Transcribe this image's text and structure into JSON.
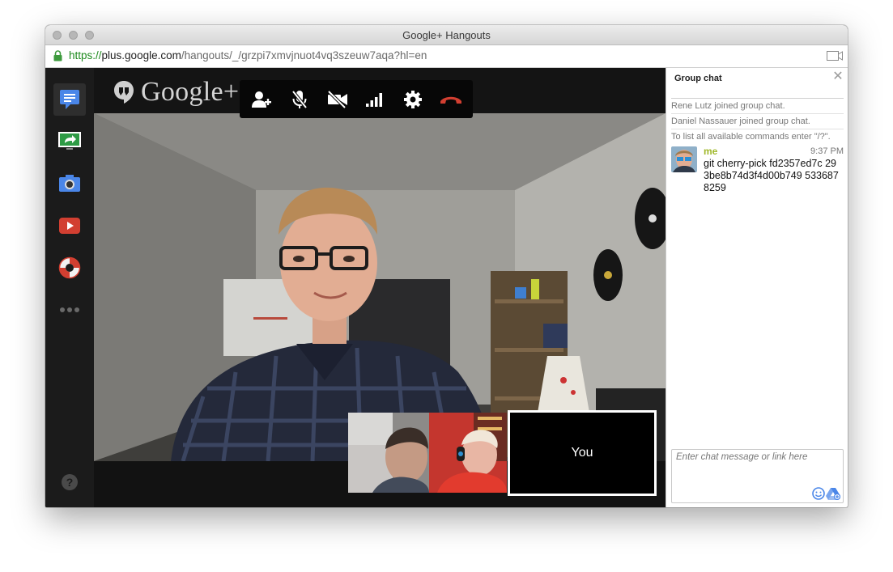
{
  "window": {
    "title": "Google+ Hangouts"
  },
  "address_bar": {
    "scheme": "https://",
    "host": "plus.google.com",
    "path": "/hangouts/_/grzpi7xmvjnuot4vq3szeuw7aqa?hl=en"
  },
  "brand": {
    "logo_text": "Google+"
  },
  "sidebar": {
    "items": [
      {
        "icon": "chat-icon",
        "active": true
      },
      {
        "icon": "screenshare-icon"
      },
      {
        "icon": "camera-icon"
      },
      {
        "icon": "youtube-icon"
      },
      {
        "icon": "lifebuoy-icon"
      },
      {
        "icon": "more-icon"
      }
    ],
    "help_label": "?"
  },
  "toolbar": {
    "buttons": [
      "add-person-icon",
      "mic-muted-icon",
      "camera-off-icon",
      "signal-icon",
      "settings-icon",
      "hang-up-icon"
    ]
  },
  "participants": {
    "self_label": "You"
  },
  "chat": {
    "title": "Group chat",
    "system_messages": [
      "Rene Lutz joined group chat.",
      "Daniel Nassauer joined group chat.",
      "To list all available commands enter \"/?\"."
    ],
    "messages": [
      {
        "author": "me",
        "time": "9:37 PM",
        "text": "git cherry-pick fd2357ed7c 293be8b74d3f4d00b749 5336878259"
      }
    ],
    "input_placeholder": "Enter chat message or link here"
  },
  "colors": {
    "accent_blue": "#4a86e8",
    "hangup_red": "#d23f31",
    "author_name": "#a0b82a",
    "secure_green": "#1e8a1e"
  }
}
